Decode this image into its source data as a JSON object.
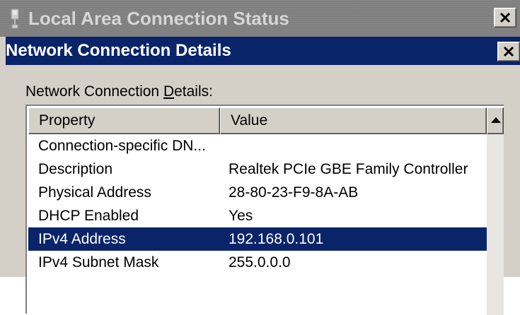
{
  "back_window": {
    "title": "Local Area Connection Status",
    "close_glyph": "✕"
  },
  "dialog": {
    "title": "Network Connection Details",
    "close_glyph": "✕",
    "group_label_pre": "Network Connection ",
    "group_label_mnemonic": "D",
    "group_label_post": "etails:",
    "columns": [
      "Property",
      "Value"
    ],
    "rows": [
      {
        "property": "Connection-specific DN...",
        "value": ""
      },
      {
        "property": "Description",
        "value": "Realtek PCIe GBE Family Controller"
      },
      {
        "property": "Physical Address",
        "value": "28-80-23-F9-8A-AB"
      },
      {
        "property": "DHCP Enabled",
        "value": "Yes"
      },
      {
        "property": "IPv4 Address",
        "value": "192.168.0.101",
        "selected": true
      },
      {
        "property": "IPv4 Subnet Mask",
        "value": "255.0.0.0"
      }
    ]
  },
  "colors": {
    "active_title": "#0a246a",
    "inactive_title": "#7f7f7f",
    "face": "#d4d0c8",
    "selection": "#0a246a"
  },
  "icons": [
    "network-connection-icon",
    "close-icon",
    "scroll-up-arrow-icon"
  ]
}
